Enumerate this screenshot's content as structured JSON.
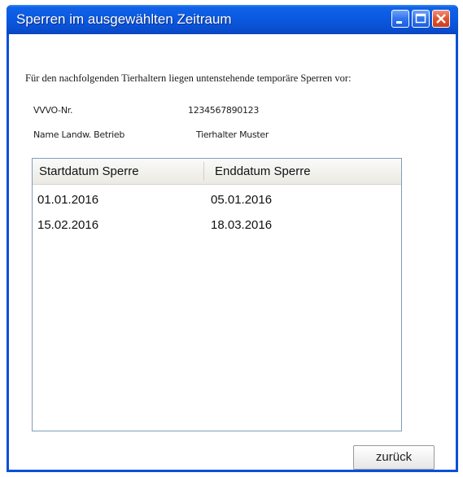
{
  "window": {
    "title": "Sperren im ausgewählten Zeitraum"
  },
  "intro_text": "Für den nachfolgenden Tierhaltern liegen untenstehende temporäre Sperren vor:",
  "info": {
    "vvvo_label": "VVVO-Nr.",
    "vvvo_value": "1234567890123",
    "betrieb_label": "Name Landw. Betrieb",
    "betrieb_value": "Tierhalter Muster"
  },
  "table": {
    "columns": [
      "Startdatum Sperre",
      "Enddatum Sperre"
    ],
    "rows": [
      [
        "01.01.2016",
        "05.01.2016"
      ],
      [
        "15.02.2016",
        "18.03.2016"
      ]
    ]
  },
  "buttons": {
    "back_label": "zurück"
  },
  "icons": {
    "minimize": "minimize-icon",
    "maximize": "maximize-icon",
    "close": "close-icon"
  },
  "colors": {
    "titlebar": "#0a58df",
    "close_button": "#e0532d",
    "list_border": "#7f9db9"
  }
}
